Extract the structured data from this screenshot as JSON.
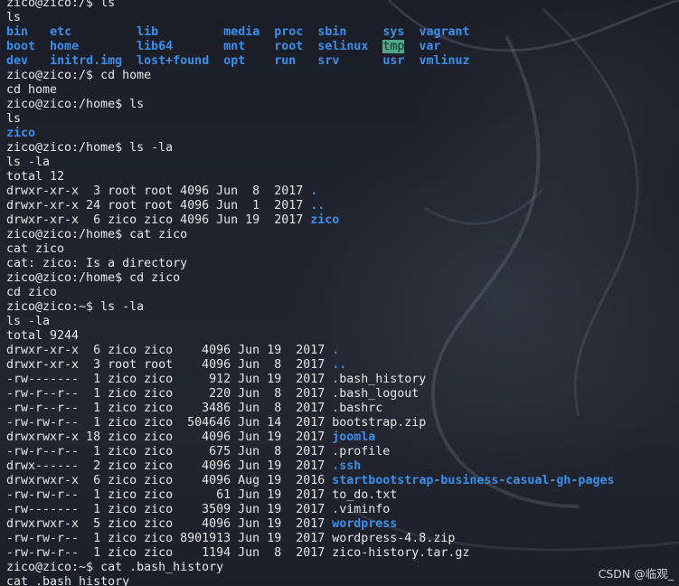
{
  "terminal": {
    "lines": [
      [
        {
          "t": "zico@zico:/$ ls"
        }
      ],
      [
        {
          "t": "ls"
        }
      ],
      [
        {
          "t": "bin",
          "c": "dir"
        },
        {
          "t": "   "
        },
        {
          "t": "etc",
          "c": "dir"
        },
        {
          "t": "         "
        },
        {
          "t": "lib",
          "c": "dir"
        },
        {
          "t": "         "
        },
        {
          "t": "media",
          "c": "dir"
        },
        {
          "t": "  "
        },
        {
          "t": "proc",
          "c": "dir"
        },
        {
          "t": "  "
        },
        {
          "t": "sbin",
          "c": "dir"
        },
        {
          "t": "     "
        },
        {
          "t": "sys",
          "c": "dir"
        },
        {
          "t": "  "
        },
        {
          "t": "vagrant",
          "c": "dir"
        }
      ],
      [
        {
          "t": "boot",
          "c": "dir"
        },
        {
          "t": "  "
        },
        {
          "t": "home",
          "c": "dir"
        },
        {
          "t": "        "
        },
        {
          "t": "lib64",
          "c": "dir"
        },
        {
          "t": "       "
        },
        {
          "t": "mnt",
          "c": "dir"
        },
        {
          "t": "    "
        },
        {
          "t": "root",
          "c": "dir"
        },
        {
          "t": "  "
        },
        {
          "t": "selinux",
          "c": "dir"
        },
        {
          "t": "  "
        },
        {
          "t": "tmp",
          "c": "hl"
        },
        {
          "t": "  "
        },
        {
          "t": "var",
          "c": "dir"
        }
      ],
      [
        {
          "t": "dev",
          "c": "dir"
        },
        {
          "t": "   "
        },
        {
          "t": "initrd.img",
          "c": "dir"
        },
        {
          "t": "  "
        },
        {
          "t": "lost+found",
          "c": "dir"
        },
        {
          "t": "  "
        },
        {
          "t": "opt",
          "c": "dir"
        },
        {
          "t": "    "
        },
        {
          "t": "run",
          "c": "dir"
        },
        {
          "t": "   "
        },
        {
          "t": "srv",
          "c": "dir"
        },
        {
          "t": "      "
        },
        {
          "t": "usr",
          "c": "dir"
        },
        {
          "t": "  "
        },
        {
          "t": "vmlinuz",
          "c": "dir"
        }
      ],
      [
        {
          "t": "zico@zico:/$ cd home"
        }
      ],
      [
        {
          "t": "cd home"
        }
      ],
      [
        {
          "t": "zico@zico:/home$ ls"
        }
      ],
      [
        {
          "t": "ls"
        }
      ],
      [
        {
          "t": "zico",
          "c": "dir"
        }
      ],
      [
        {
          "t": "zico@zico:/home$ ls -la"
        }
      ],
      [
        {
          "t": "ls -la"
        }
      ],
      [
        {
          "t": "total 12"
        }
      ],
      [
        {
          "t": "drwxr-xr-x  3 root root 4096 Jun  8  2017 "
        },
        {
          "t": ".",
          "c": "dir"
        }
      ],
      [
        {
          "t": "drwxr-xr-x 24 root root 4096 Jun  1  2017 "
        },
        {
          "t": "..",
          "c": "dir"
        }
      ],
      [
        {
          "t": "drwxr-xr-x  6 zico zico 4096 Jun 19  2017 "
        },
        {
          "t": "zico",
          "c": "dir"
        }
      ],
      [
        {
          "t": "zico@zico:/home$ cat zico"
        }
      ],
      [
        {
          "t": "cat zico"
        }
      ],
      [
        {
          "t": "cat: zico: Is a directory"
        }
      ],
      [
        {
          "t": "zico@zico:/home$ cd zico"
        }
      ],
      [
        {
          "t": "cd zico"
        }
      ],
      [
        {
          "t": "zico@zico:~$ ls -la"
        }
      ],
      [
        {
          "t": "ls -la"
        }
      ],
      [
        {
          "t": "total 9244"
        }
      ],
      [
        {
          "t": "drwxr-xr-x  6 zico zico    4096 Jun 19  2017 "
        },
        {
          "t": ".",
          "c": "dir"
        }
      ],
      [
        {
          "t": "drwxr-xr-x  3 root root    4096 Jun  8  2017 "
        },
        {
          "t": "..",
          "c": "dir"
        }
      ],
      [
        {
          "t": "-rw-------  1 zico zico     912 Jun 19  2017 .bash_history"
        }
      ],
      [
        {
          "t": "-rw-r--r--  1 zico zico     220 Jun  8  2017 .bash_logout"
        }
      ],
      [
        {
          "t": "-rw-r--r--  1 zico zico    3486 Jun  8  2017 .bashrc"
        }
      ],
      [
        {
          "t": "-rw-rw-r--  1 zico zico  504646 Jun 14  2017 bootstrap.zip"
        }
      ],
      [
        {
          "t": "drwxrwxr-x 18 zico zico    4096 Jun 19  2017 "
        },
        {
          "t": "joomla",
          "c": "dir"
        }
      ],
      [
        {
          "t": "-rw-r--r--  1 zico zico     675 Jun  8  2017 .profile"
        }
      ],
      [
        {
          "t": "drwx------  2 zico zico    4096 Jun 19  2017 "
        },
        {
          "t": ".ssh",
          "c": "dir"
        }
      ],
      [
        {
          "t": "drwxrwxr-x  6 zico zico    4096 Aug 19  2016 "
        },
        {
          "t": "startbootstrap-business-casual-gh-pages",
          "c": "dir"
        }
      ],
      [
        {
          "t": "-rw-rw-r--  1 zico zico      61 Jun 19  2017 to_do.txt"
        }
      ],
      [
        {
          "t": "-rw-------  1 zico zico    3509 Jun 19  2017 .viminfo"
        }
      ],
      [
        {
          "t": "drwxrwxr-x  5 zico zico    4096 Jun 19  2017 "
        },
        {
          "t": "wordpress",
          "c": "dir"
        }
      ],
      [
        {
          "t": "-rw-rw-r--  1 zico zico 8901913 Jun 19  2017 wordpress-4.8.zip"
        }
      ],
      [
        {
          "t": "-rw-rw-r--  1 zico zico    1194 Jun  8  2017 zico-history.tar.gz"
        }
      ],
      [
        {
          "t": "zico@zico:~$ cat .bash_history"
        }
      ],
      [
        {
          "t": "cat .bash_history"
        }
      ]
    ]
  },
  "watermark": "CSDN @临观_",
  "colors": {
    "background": "#1e2129",
    "text": "#e6e6e6",
    "directory": "#3b8eea",
    "highlight_bg": "#4fa88a"
  }
}
